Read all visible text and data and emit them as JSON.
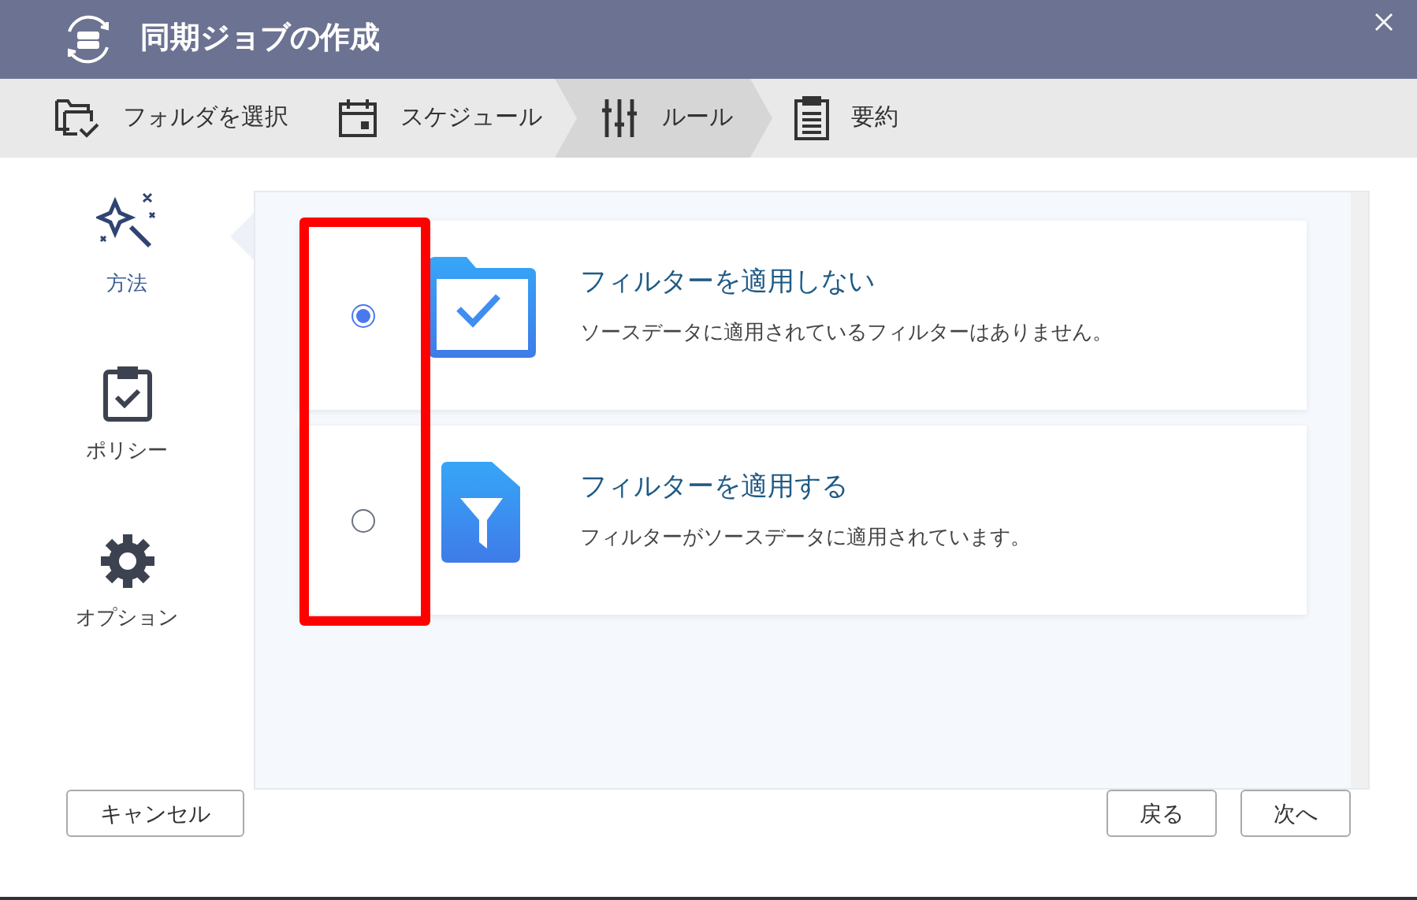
{
  "window": {
    "title": "同期ジョブの作成"
  },
  "steps": [
    {
      "label": "フォルダを選択",
      "selected": false
    },
    {
      "label": "スケジュール",
      "selected": false
    },
    {
      "label": "ルール",
      "selected": true
    },
    {
      "label": "要約",
      "selected": false
    }
  ],
  "sidebar": {
    "items": [
      {
        "label": "方法",
        "selected": true
      },
      {
        "label": "ポリシー",
        "selected": false
      },
      {
        "label": "オプション",
        "selected": false
      }
    ]
  },
  "options": [
    {
      "title": "フィルターを適用しない",
      "description": "ソースデータに適用されているフィルターはありません。",
      "selected": true
    },
    {
      "title": "フィルターを適用する",
      "description": "フィルターがソースデータに適用されています。",
      "selected": false
    }
  ],
  "buttons": {
    "cancel": "キャンセル",
    "back": "戻る",
    "next": "次へ"
  }
}
